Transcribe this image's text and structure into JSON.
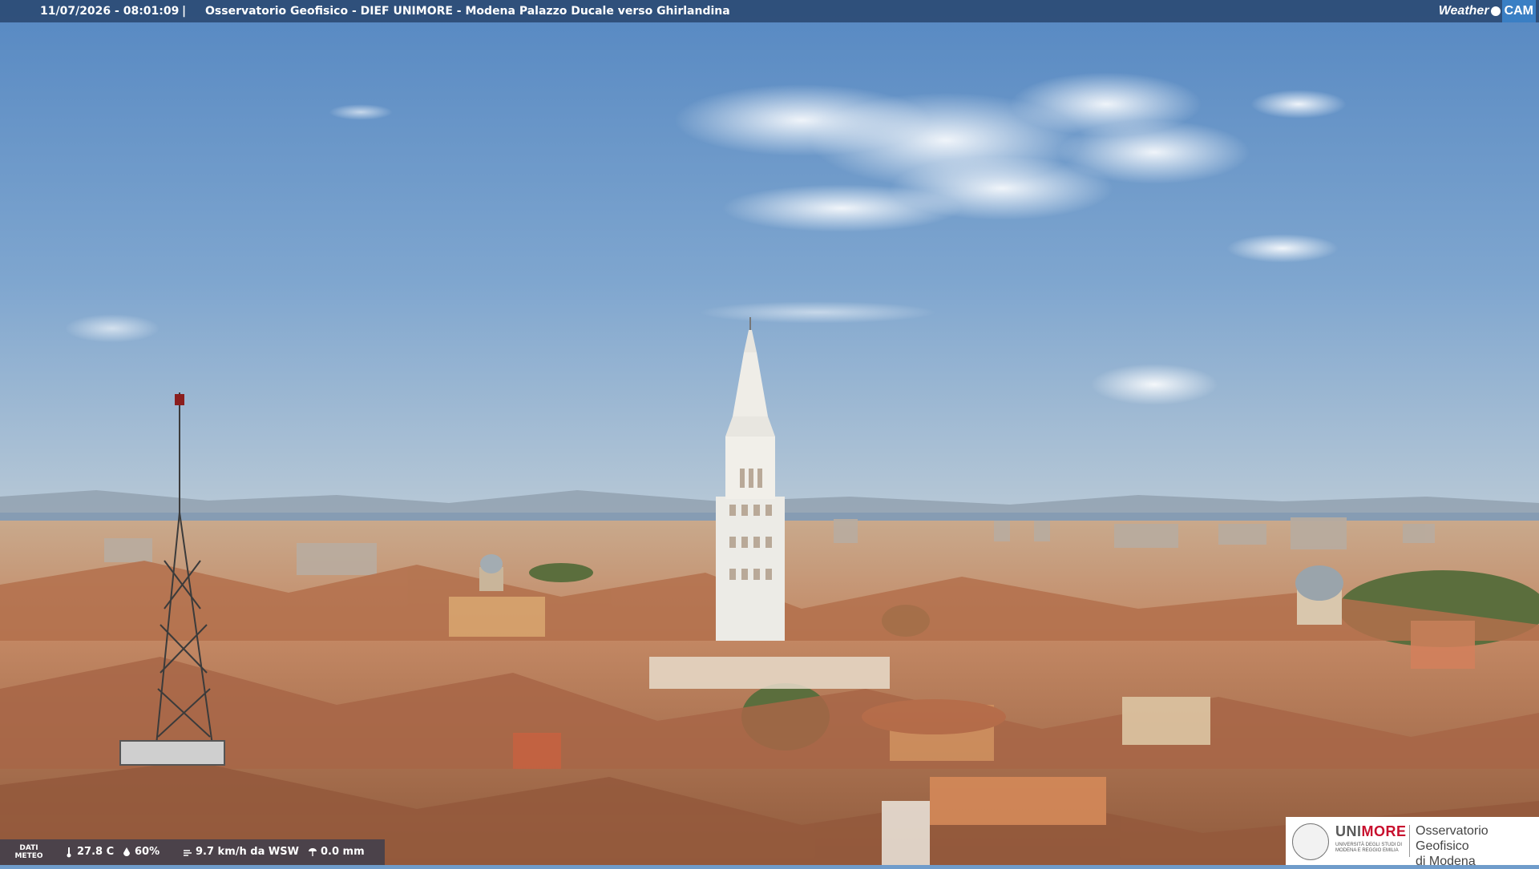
{
  "overlay": {
    "timestamp": "11/07/2026 - 08:01:09",
    "separator": "|",
    "title": "Osservatorio Geofisico - DIEF UNIMORE - Modena Palazzo Ducale verso Ghirlandina",
    "logo_weather": "Weather",
    "logo_cam": "CAM"
  },
  "meteo": {
    "label_line1": "DATI",
    "label_line2": "METEO",
    "temperature": "27.8 C",
    "humidity": "60%",
    "wind": "9.7 km/h da WSW",
    "rain": "0.0 mm",
    "icons": [
      "thermometer-icon",
      "humidity-drop-icon",
      "wind-icon",
      "rain-icon"
    ]
  },
  "brand": {
    "uni_prefix": "UNI",
    "uni_suffix": "MORE",
    "uni_sub": "UNIVERSITÀ DEGLI STUDI DI MODENA E REGGIO EMILIA",
    "observatory_line1": "Osservatorio Geofisico",
    "observatory_line2": "di Modena"
  },
  "colors": {
    "sky_top": "#5d8dc4",
    "sky_horizon": "#a9c3d8",
    "rooftops": "#b9774f",
    "tower": "#ecebe6",
    "overlay_bar": "#203a60",
    "brand_red": "#c8102e"
  }
}
